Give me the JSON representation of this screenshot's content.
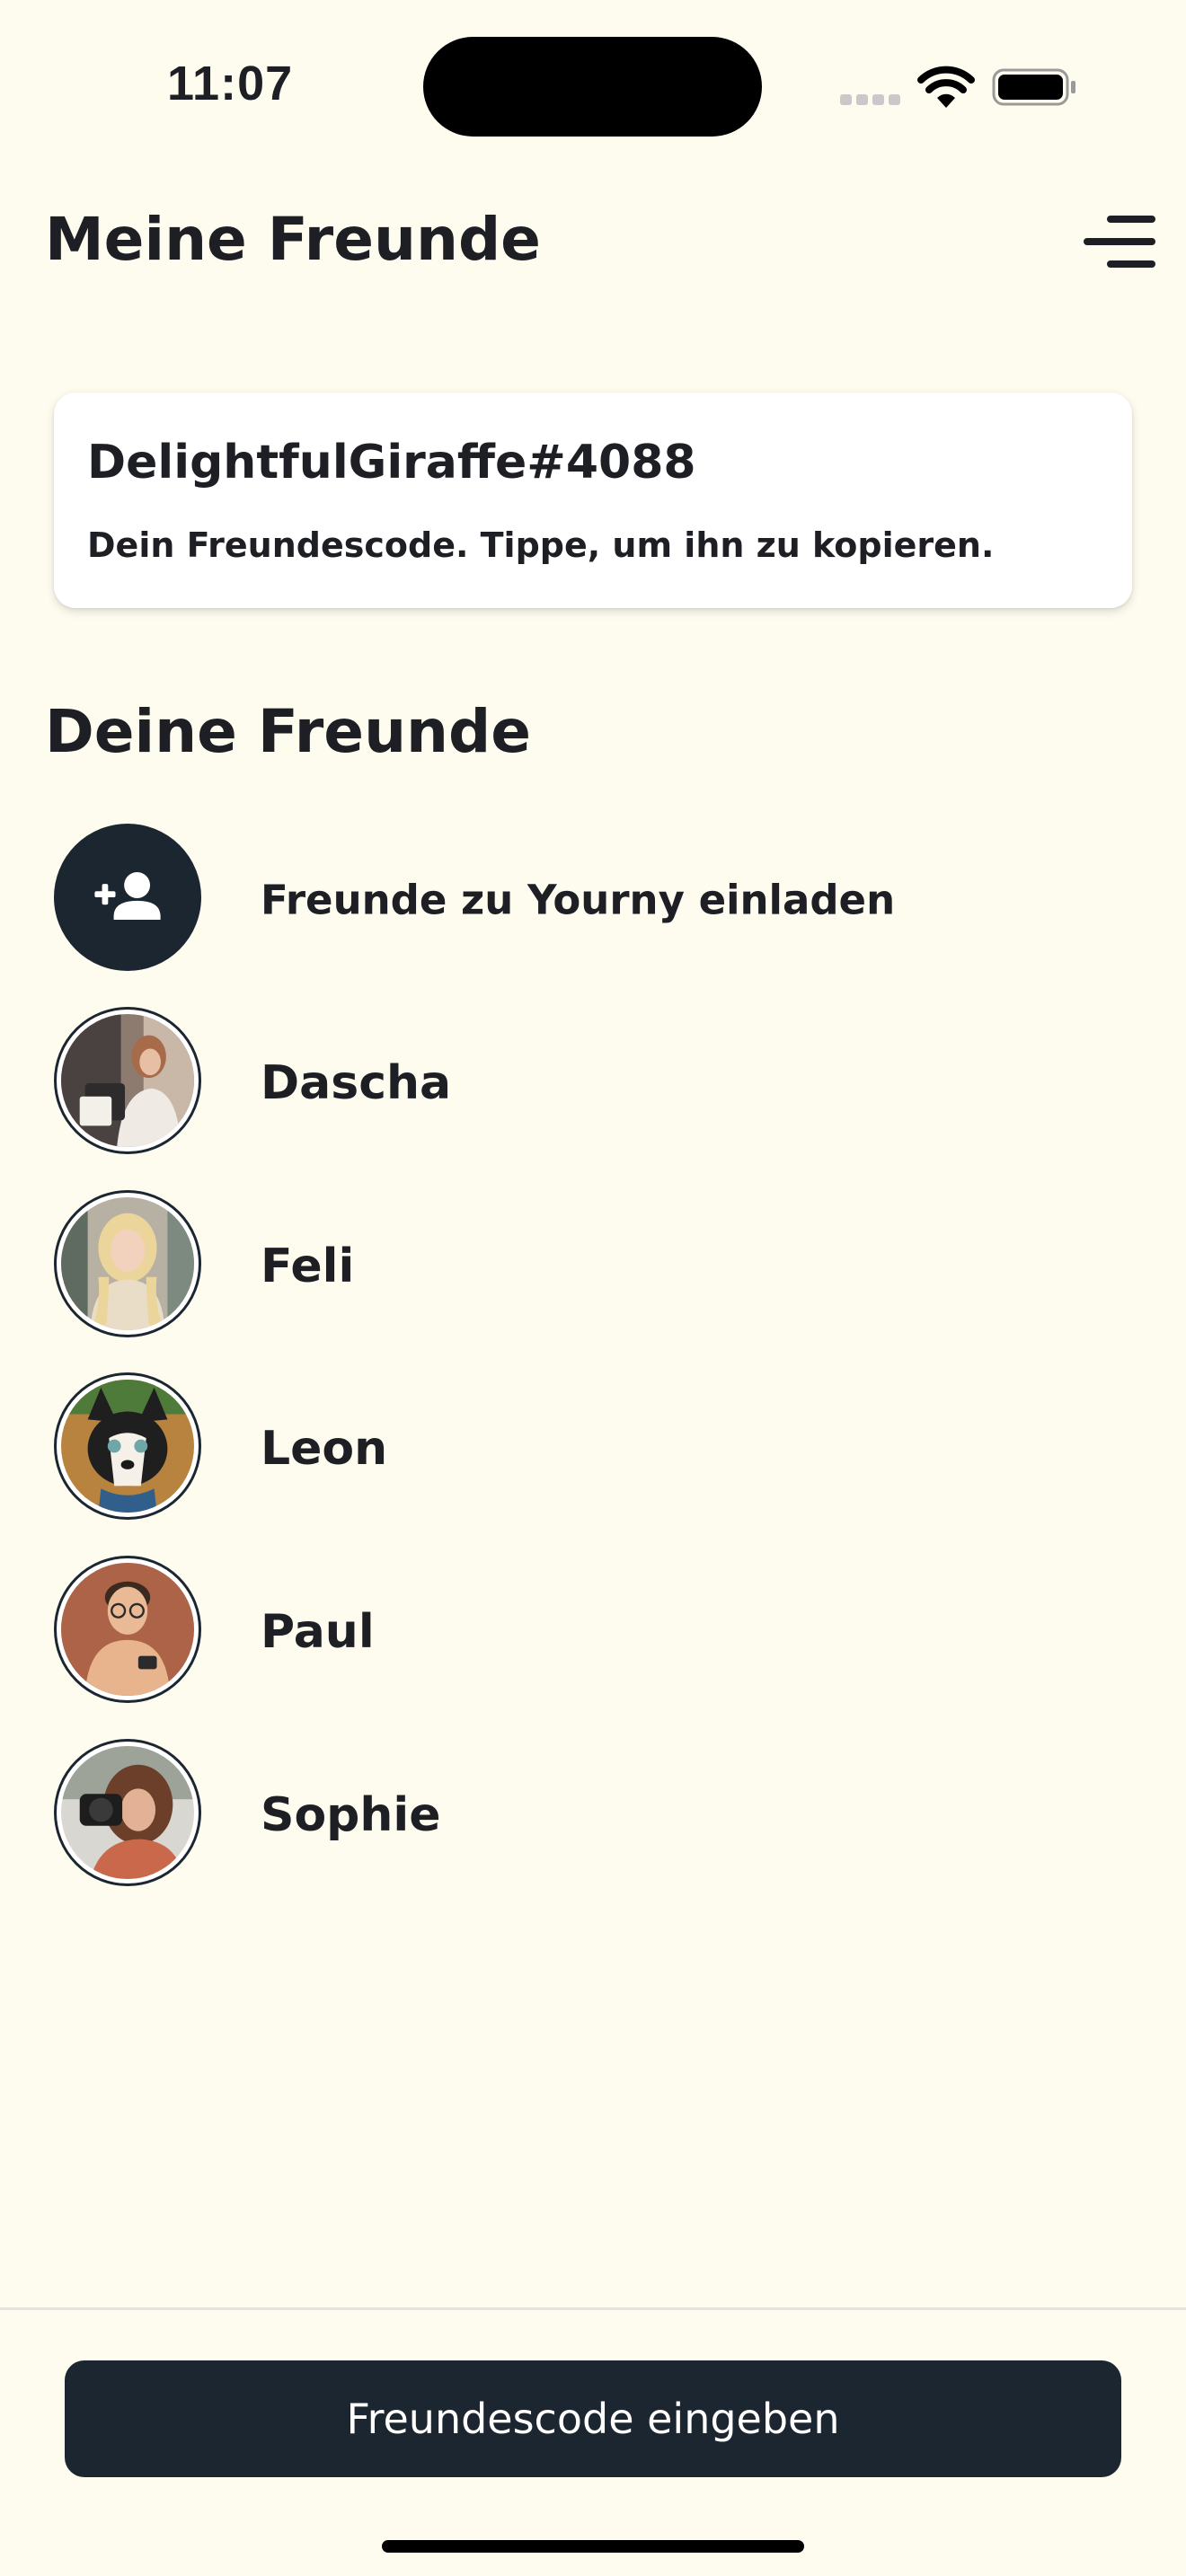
{
  "status_bar": {
    "time": "11:07"
  },
  "header": {
    "title": "Meine Freunde",
    "menu_icon": "menu-icon"
  },
  "friend_code_card": {
    "code": "DelightfulGiraffe#4088",
    "hint": "Dein Freundescode. Tippe, um ihn zu kopieren."
  },
  "friends_section": {
    "title": "Deine Freunde",
    "invite": {
      "label": "Freunde zu Yourny einladen",
      "icon": "add-user-icon"
    },
    "friends": [
      {
        "name": "Dascha"
      },
      {
        "name": "Feli"
      },
      {
        "name": "Leon"
      },
      {
        "name": "Paul"
      },
      {
        "name": "Sophie"
      }
    ]
  },
  "footer": {
    "button_label": "Freundescode eingeben"
  },
  "colors": {
    "background": "#fefcef",
    "primary_dark": "#1b2631",
    "text": "#1e1f24",
    "card": "#ffffff"
  }
}
